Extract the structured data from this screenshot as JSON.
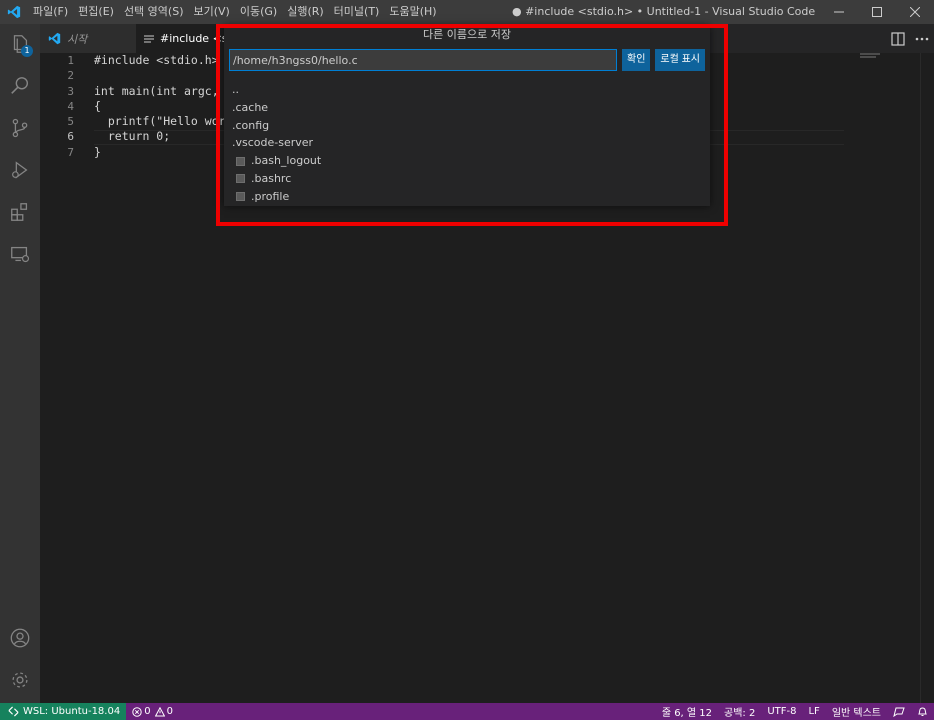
{
  "window": {
    "title": "● #include <stdio.h> • Untitled-1 - Visual Studio Code"
  },
  "menu": [
    {
      "label": "파일(F)"
    },
    {
      "label": "편집(E)"
    },
    {
      "label": "선택 영역(S)"
    },
    {
      "label": "보기(V)"
    },
    {
      "label": "이동(G)"
    },
    {
      "label": "실행(R)"
    },
    {
      "label": "터미널(T)"
    },
    {
      "label": "도움말(H)"
    }
  ],
  "activity": {
    "explorer_badge": "1",
    "icons": [
      "explorer-icon",
      "search-icon",
      "source-control-icon",
      "run-debug-icon",
      "extensions-icon",
      "remote-explorer-icon",
      "account-icon",
      "settings-gear-icon"
    ]
  },
  "tabs": {
    "welcome": "시작",
    "file": "#include <st"
  },
  "editor": {
    "line_numbers": [
      "1",
      "2",
      "3",
      "4",
      "5",
      "6",
      "7"
    ],
    "lines": [
      "#include <stdio.h>",
      "",
      "int main(int argc, ch",
      "{",
      "  printf(\"Hello world",
      "  return 0;",
      "}"
    ],
    "active_line": 6
  },
  "save_dialog": {
    "title": "다른 이름으로 저장",
    "path_value": "/home/h3ngss0/hello.c",
    "ok_button": "확인",
    "show_local_button": "로컬 표시",
    "items": [
      {
        "label": "..",
        "kind": "folder"
      },
      {
        "label": ".cache",
        "kind": "folder"
      },
      {
        "label": ".config",
        "kind": "folder"
      },
      {
        "label": ".vscode-server",
        "kind": "folder"
      },
      {
        "label": ".bash_logout",
        "kind": "file"
      },
      {
        "label": ".bashrc",
        "kind": "file"
      },
      {
        "label": ".profile",
        "kind": "file"
      }
    ]
  },
  "statusbar": {
    "remote": "WSL: Ubuntu-18.04",
    "errors": "0",
    "warnings": "0",
    "position": "줄 6, 열 12",
    "indent": "공백: 2",
    "encoding": "UTF-8",
    "eol": "LF",
    "language": "일반 텍스트"
  },
  "colors": {
    "statusbar": "#68217a",
    "remote": "#16825d",
    "accent": "#0e639c",
    "highlight": "#ee0000"
  }
}
